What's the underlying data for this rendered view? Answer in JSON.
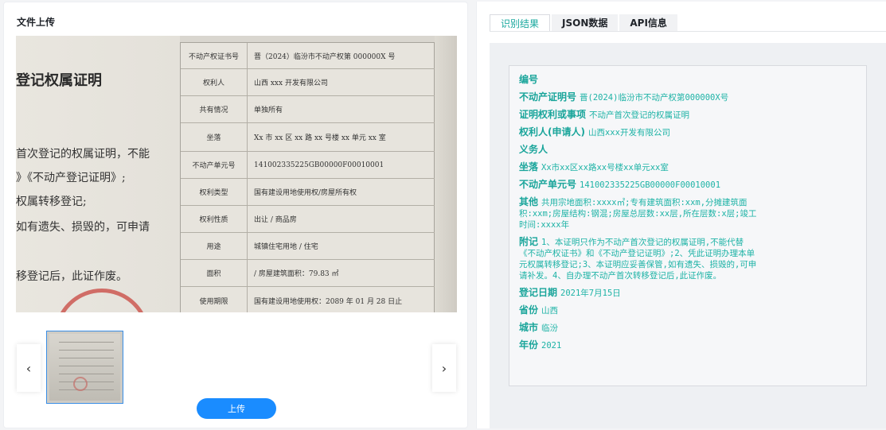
{
  "upload_panel": {
    "title": "文件上传",
    "upload_button": "上传",
    "prev_icon": "chevron-left-icon",
    "next_icon": "chevron-right-icon"
  },
  "preview": {
    "left_lines": [
      "登记权属证明",
      "首次登记的权属证明，不能",
      "》《不动产登记证明》;",
      "权属转移登记;",
      "如有遗失、损毁的，可申请",
      "移登记后，此证作废。"
    ],
    "rows": [
      {
        "k": "不动产权证书号",
        "v": "晋（2024）临汾市不动产权第 000000X 号"
      },
      {
        "k": "权利人",
        "v": "山西 xxx 开发有限公司"
      },
      {
        "k": "共有情况",
        "v": "单独所有"
      },
      {
        "k": "坐落",
        "v": "Xx 市 xx 区 xx 路 xx 号楼 xx 单元 xx 室"
      },
      {
        "k": "不动产单元号",
        "v": "141002335225GB00000F00010001"
      },
      {
        "k": "权利类型",
        "v": "国有建设用地使用权/房屋所有权"
      },
      {
        "k": "权利性质",
        "v": "出让 / 商品房"
      },
      {
        "k": "用途",
        "v": "城镇住宅用地 / 住宅"
      },
      {
        "k": "面积",
        "v": "/ 房屋建筑面积：79.83 ㎡"
      },
      {
        "k": "使用期限",
        "v": "国有建设用地使用权：2089 年 01 月 28 日止"
      }
    ]
  },
  "tabs": [
    {
      "label": "识别结果",
      "active": true
    },
    {
      "label": "JSON数据",
      "active": false
    },
    {
      "label": "API信息",
      "active": false
    }
  ],
  "result": {
    "fields": [
      {
        "k": "编号",
        "v": ""
      },
      {
        "k": "不动产证明号",
        "v": "晋(2024)临汾市不动产权第000000X号"
      },
      {
        "k": "证明权利或事项",
        "v": "不动产首次登记的权属证明"
      },
      {
        "k": "权利人(申请人)",
        "v": "山西xxx开发有限公司"
      },
      {
        "k": "义务人",
        "v": ""
      },
      {
        "k": "坐落",
        "v": "Xx市xx区xx路xx号楼xx单元xx室"
      },
      {
        "k": "不动产单元号",
        "v": "141002335225GB00000F00010001"
      },
      {
        "k": "其他",
        "v": "共用宗地面积:xxxx㎡;专有建筑面积:xxm,分摊建筑面积:xxm;房屋结构:钢混;房屋总层数:xx层,所在层数:x层;竣工时间:xxxx年"
      },
      {
        "k": "附记",
        "v": "1、本证明只作为不动产首次登记的权属证明,不能代替《不动产权证书》和《不动产登记证明》;2、凭此证明办理本单元权属转移登记;3、本证明应妥善保管,如有遗失、损毁的,可申请补发。4、自办理不动产首次转移登记后,此证作废。"
      },
      {
        "k": "登记日期",
        "v": "2021年7月15日"
      },
      {
        "k": "省份",
        "v": "山西"
      },
      {
        "k": "城市",
        "v": "临汾"
      },
      {
        "k": "年份",
        "v": "2021"
      }
    ]
  },
  "colors": {
    "accent": "#1a8cff",
    "result_text": "#19a89e"
  }
}
